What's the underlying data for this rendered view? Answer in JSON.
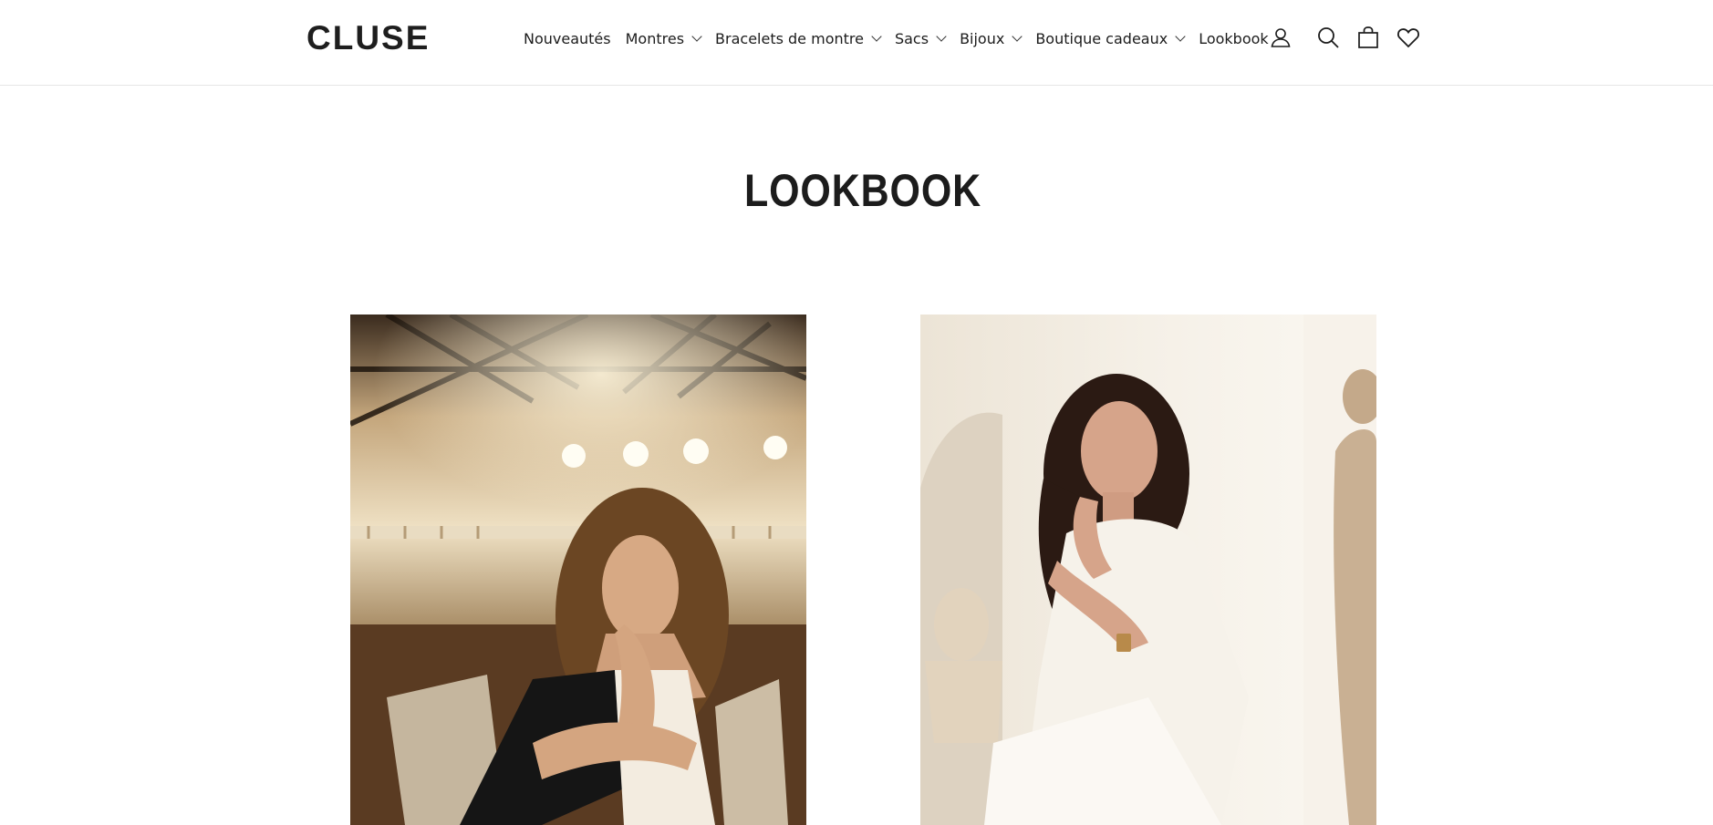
{
  "header": {
    "logo": "CLUSE",
    "nav": [
      {
        "label": "Nouveautés",
        "has_dropdown": false
      },
      {
        "label": "Montres",
        "has_dropdown": true
      },
      {
        "label": "Bracelets de montre",
        "has_dropdown": true
      },
      {
        "label": "Sacs",
        "has_dropdown": true
      },
      {
        "label": "Bijoux",
        "has_dropdown": true
      },
      {
        "label": "Boutique cadeaux",
        "has_dropdown": true
      },
      {
        "label": "Lookbook",
        "has_dropdown": false
      }
    ],
    "icons": [
      "account-icon",
      "search-icon",
      "cart-icon",
      "wishlist-heart-icon"
    ]
  },
  "main": {
    "title": "LOOKBOOK",
    "images": [
      {
        "name": "lookbook-image-riding-hall",
        "palette": [
          "#3b2a1a",
          "#c9a877",
          "#f4e6cc",
          "#6b4a2a"
        ]
      },
      {
        "name": "lookbook-image-white-suit",
        "palette": [
          "#f3ede4",
          "#e6dccd",
          "#c7ad8f",
          "#2a1a14"
        ]
      }
    ]
  },
  "colors": {
    "text": "#1c1c1c",
    "border": "#e6e6e6",
    "background": "#ffffff"
  }
}
